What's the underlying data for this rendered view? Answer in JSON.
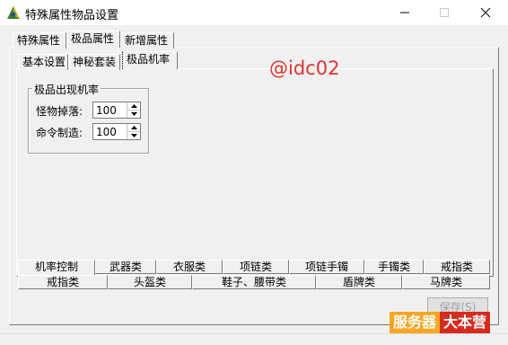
{
  "window": {
    "title": "特殊属性物品设置"
  },
  "main_tabs": [
    {
      "label": "特殊属性"
    },
    {
      "label": "极品属性"
    },
    {
      "label": "新增属性"
    }
  ],
  "sub_tabs": [
    {
      "label": "基本设置"
    },
    {
      "label": "神秘套装"
    },
    {
      "label": "极品机率"
    }
  ],
  "group": {
    "title": "极品出现机率",
    "fields": [
      {
        "label": "怪物掉落:",
        "value": "100"
      },
      {
        "label": "命令制造:",
        "value": "100"
      }
    ]
  },
  "watermark": "@idc02",
  "category_tabs_row1": [
    {
      "label": "机率控制"
    },
    {
      "label": "武器类"
    },
    {
      "label": "衣服类"
    },
    {
      "label": "项链类"
    },
    {
      "label": "项链手镯"
    },
    {
      "label": "手镯类"
    },
    {
      "label": "戒指类"
    }
  ],
  "category_tabs_row2": [
    {
      "label": "戒指类"
    },
    {
      "label": "头盔类"
    },
    {
      "label": "鞋子、腰带类"
    },
    {
      "label": "盾牌类"
    },
    {
      "label": "马牌类"
    }
  ],
  "save_button": "保存(S)",
  "brand": {
    "part1": "服务器",
    "part2": "大本营"
  },
  "colors": {
    "watermark": "#e0332e",
    "brand_orange": "#f5a623",
    "brand_red": "#d52b1e"
  }
}
